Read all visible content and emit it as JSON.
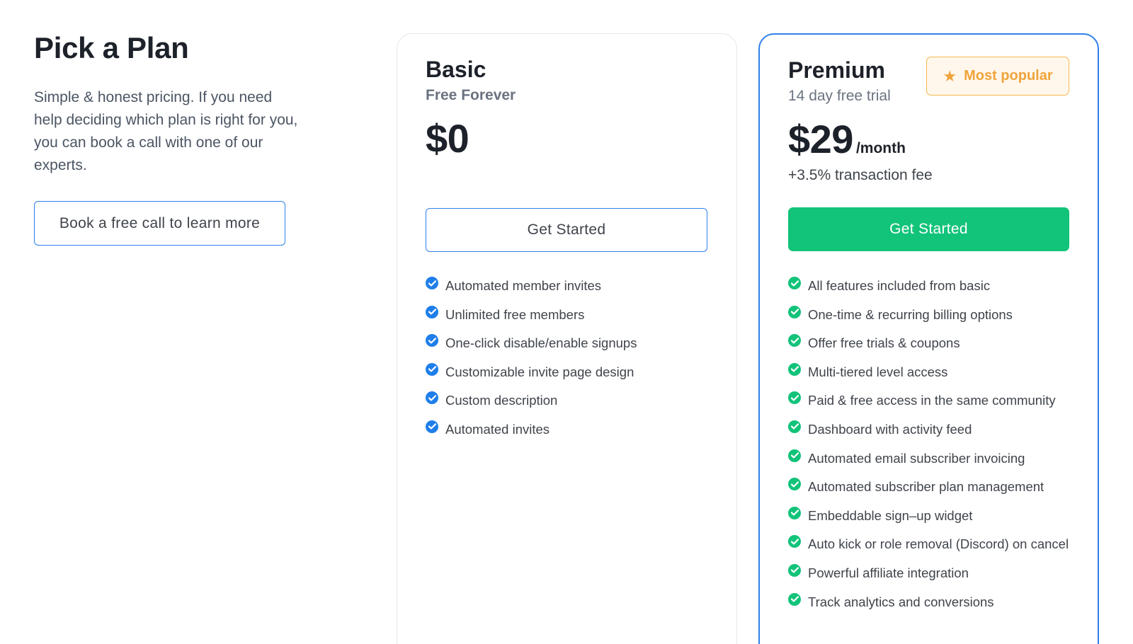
{
  "intro": {
    "title": "Pick a Plan",
    "description": "Simple & honest pricing. If you need help deciding which plan is right for you, you can book a call with one of our experts.",
    "book_call_label": "Book a free call to learn more"
  },
  "colors": {
    "accent_blue": "#2f80ed",
    "check_blue": "#1f7fea",
    "check_green": "#12c37a",
    "cta_green": "#12c37a",
    "badge_orange": "#f0a43a",
    "badge_bg": "#fff7ec"
  },
  "plans": {
    "basic": {
      "name": "Basic",
      "subtitle": "Free Forever",
      "price": "$0",
      "cta_label": "Get Started",
      "features": [
        "Automated member invites",
        "Unlimited free members",
        "One-click disable/enable signups",
        "Customizable invite page design",
        "Custom description",
        "Automated invites"
      ]
    },
    "premium": {
      "name": "Premium",
      "subtitle": "14 day free trial",
      "price": "$29",
      "price_unit": "/month",
      "fee": "+3.5% transaction fee",
      "badge_label": "Most popular",
      "badge_icon": "star-icon",
      "cta_label": "Get Started",
      "features": [
        "All features included from basic",
        "One-time & recurring billing options",
        "Offer free trials & coupons",
        "Multi-tiered level access",
        "Paid & free access in the same community",
        "Dashboard with activity feed",
        "Automated email subscriber invoicing",
        "Automated subscriber plan management",
        "Embeddable sign–up widget",
        "Auto kick or role removal (Discord) on cancel",
        "Powerful affiliate integration",
        "Track analytics and conversions"
      ]
    }
  }
}
